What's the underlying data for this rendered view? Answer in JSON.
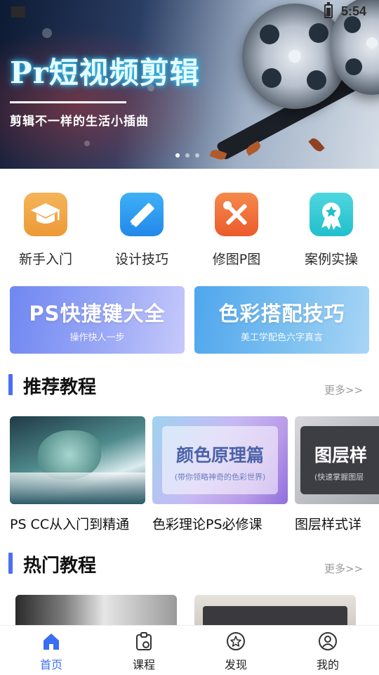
{
  "status_bar": {
    "time": "5:54"
  },
  "banner": {
    "title": "Pr短视频剪辑",
    "subtitle": "剪辑不一样的生活小插曲"
  },
  "categories": [
    {
      "label": "新手入门",
      "icon": "graduation-cap-icon",
      "color": "#f0a74b"
    },
    {
      "label": "设计技巧",
      "icon": "ruler-pencil-icon",
      "color": "#2f9cf2"
    },
    {
      "label": "修图P图",
      "icon": "tools-icon",
      "color": "#f1693a"
    },
    {
      "label": "案例实操",
      "icon": "award-ribbon-icon",
      "color": "#33cbd7"
    }
  ],
  "promos": [
    {
      "title": "PS快捷键大全",
      "subtitle": "操作快人一步"
    },
    {
      "title": "色彩搭配技巧",
      "subtitle": "美工学配色六字真言"
    }
  ],
  "recommended": {
    "title": "推荐教程",
    "more": "更多>>",
    "items": [
      {
        "title": "PS CC从入门到精通"
      },
      {
        "title": "色彩理论PS必修课",
        "thumb_title": "颜色原理篇",
        "thumb_sub": "(带你领略神奇的色彩世界)"
      },
      {
        "title": "图层样式详",
        "thumb_title": "图层样",
        "thumb_sub": "(快速掌握图层"
      }
    ]
  },
  "hot": {
    "title": "热门教程",
    "more": "更多>>"
  },
  "nav": [
    {
      "label": "首页",
      "icon": "home-icon",
      "active": true
    },
    {
      "label": "课程",
      "icon": "course-icon",
      "active": false
    },
    {
      "label": "发现",
      "icon": "discover-star-icon",
      "active": false
    },
    {
      "label": "我的",
      "icon": "profile-icon",
      "active": false
    }
  ],
  "colors": {
    "accent": "#3b6df2",
    "section_bar": "#4c6ef5"
  }
}
